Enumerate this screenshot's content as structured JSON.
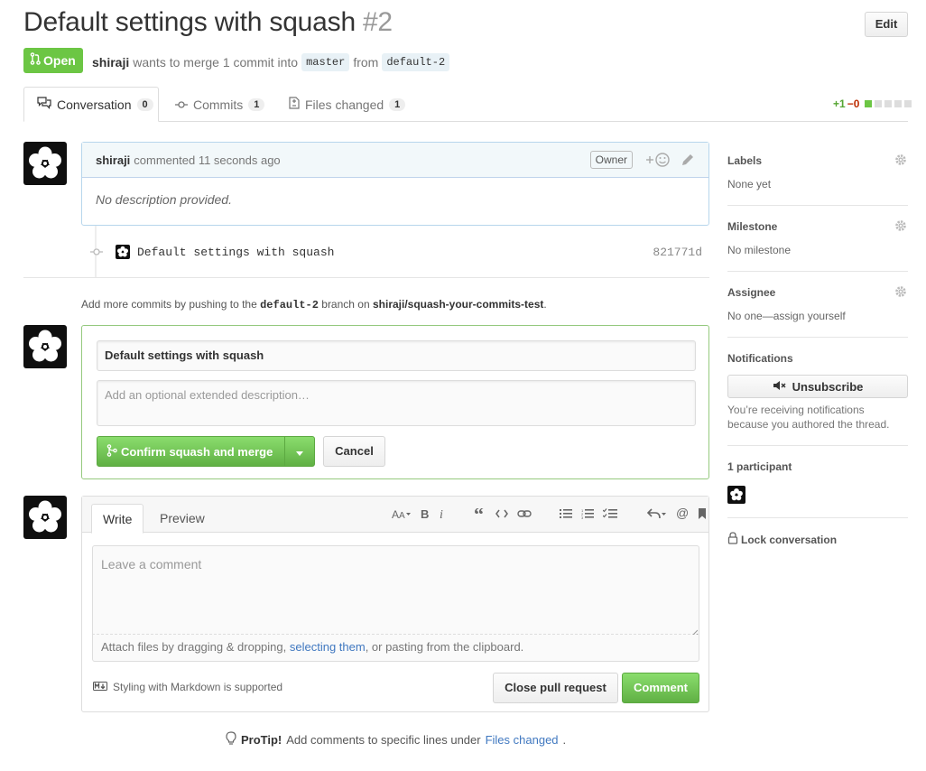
{
  "pr": {
    "title": "Default settings with squash",
    "number": "#2",
    "edit_label": "Edit",
    "state": "Open",
    "author": "shiraji",
    "meta_text": "wants to merge 1 commit into",
    "base_branch": "master",
    "from_text": "from",
    "head_branch": "default-2"
  },
  "tabs": [
    {
      "label": "Conversation",
      "count": "0"
    },
    {
      "label": "Commits",
      "count": "1"
    },
    {
      "label": "Files changed",
      "count": "1"
    }
  ],
  "diffstat": {
    "additions": "+1",
    "deletions": "−0"
  },
  "comment": {
    "author": "shiraji",
    "action": "commented 11 seconds ago",
    "badge": "Owner",
    "body": "No description provided."
  },
  "commit": {
    "message": "Default settings with squash",
    "sha": "821771d"
  },
  "info": {
    "prefix": "Add more commits by pushing to the",
    "branch": "default-2",
    "middle": "branch on",
    "repo": "shiraji/squash-your-commits-test",
    "suffix": "."
  },
  "merge": {
    "commit_title": "Default settings with squash",
    "description_placeholder": "Add an optional extended description…",
    "confirm_label": "Confirm squash and merge",
    "cancel_label": "Cancel"
  },
  "new_comment": {
    "write_tab": "Write",
    "preview_tab": "Preview",
    "placeholder": "Leave a comment",
    "attach_prefix": "Attach files by dragging & dropping,",
    "attach_link": "selecting them",
    "attach_suffix": ", or pasting from the clipboard.",
    "markdown_note": "Styling with Markdown is supported",
    "close_label": "Close pull request",
    "comment_label": "Comment"
  },
  "protip": {
    "label": "ProTip!",
    "text": "Add comments to specific lines under",
    "link": "Files changed",
    "suffix": "."
  },
  "sidebar": {
    "labels_title": "Labels",
    "labels_value": "None yet",
    "milestone_title": "Milestone",
    "milestone_value": "No milestone",
    "assignee_title": "Assignee",
    "assignee_value": "No one—assign yourself",
    "notifications_title": "Notifications",
    "unsubscribe_label": "Unsubscribe",
    "notifications_text": "You’re receiving notifications because you authored the thread.",
    "participants_title": "1 participant",
    "lock_label": "Lock conversation"
  },
  "colors": {
    "open_green": "#6cc644",
    "link_blue": "#4078c0",
    "merge_border": "#95c97e"
  }
}
